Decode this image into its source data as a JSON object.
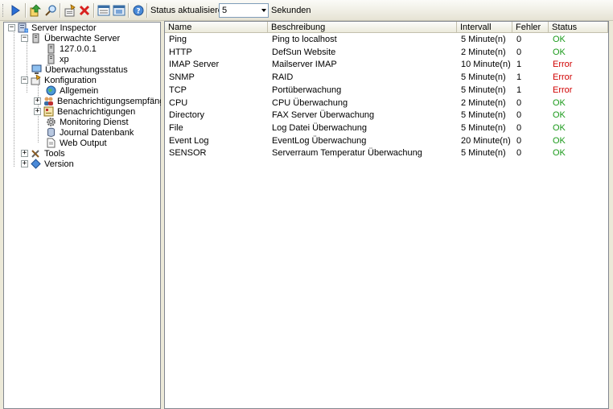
{
  "toolbar": {
    "status_label": "Status aktualisieren:",
    "interval_value": "5",
    "interval_unit": "Sekunden",
    "icons": [
      "play-icon",
      "export-icon",
      "search-tool-icon",
      "settings-icon",
      "delete-icon",
      "list-view-icon",
      "window-icon",
      "help-icon"
    ]
  },
  "tree": {
    "root": "Server Inspector",
    "monitored_servers": "Überwachte Server",
    "server_1": "127.0.0.1",
    "server_2": "xp",
    "monitoring_status": "Überwachungsstatus",
    "configuration": "Konfiguration",
    "general": "Allgemein",
    "notification_recipients": "Benachrichtigungsempfänger",
    "notifications": "Benachrichtigungen",
    "monitoring_service": "Monitoring Dienst",
    "journal_db": "Journal Datenbank",
    "web_output": "Web Output",
    "tools": "Tools",
    "version": "Version"
  },
  "list": {
    "columns": [
      "Name",
      "Beschreibung",
      "Intervall",
      "Fehler",
      "Status"
    ],
    "rows": [
      {
        "name": "Ping",
        "description": "Ping to localhost",
        "interval": "5 Minute(n)",
        "errors": "0",
        "status": "OK"
      },
      {
        "name": "HTTP",
        "description": "DefSun Website",
        "interval": "2 Minute(n)",
        "errors": "0",
        "status": "OK"
      },
      {
        "name": "IMAP Server",
        "description": "Mailserver IMAP",
        "interval": "10 Minute(n)",
        "errors": "1",
        "status": "Error"
      },
      {
        "name": "SNMP",
        "description": "RAID",
        "interval": "5 Minute(n)",
        "errors": "1",
        "status": "Error"
      },
      {
        "name": "TCP",
        "description": "Portüberwachung",
        "interval": "5 Minute(n)",
        "errors": "1",
        "status": "Error"
      },
      {
        "name": "CPU",
        "description": "CPU Überwachung",
        "interval": "2 Minute(n)",
        "errors": "0",
        "status": "OK"
      },
      {
        "name": "Directory",
        "description": "FAX Server Überwachung",
        "interval": "5 Minute(n)",
        "errors": "0",
        "status": "OK"
      },
      {
        "name": "File",
        "description": "Log Datei Überwachung",
        "interval": "5 Minute(n)",
        "errors": "0",
        "status": "OK"
      },
      {
        "name": "Event Log",
        "description": "EventLog Überwachung",
        "interval": "20 Minute(n)",
        "errors": "0",
        "status": "OK"
      },
      {
        "name": "SENSOR",
        "description": "Serverraum Temperatur Überwachung",
        "interval": "5 Minute(n)",
        "errors": "0",
        "status": "OK"
      }
    ]
  },
  "colors": {
    "ok": "#1a9a1a",
    "error": "#d00000",
    "window_bg": "#ece9d8"
  }
}
